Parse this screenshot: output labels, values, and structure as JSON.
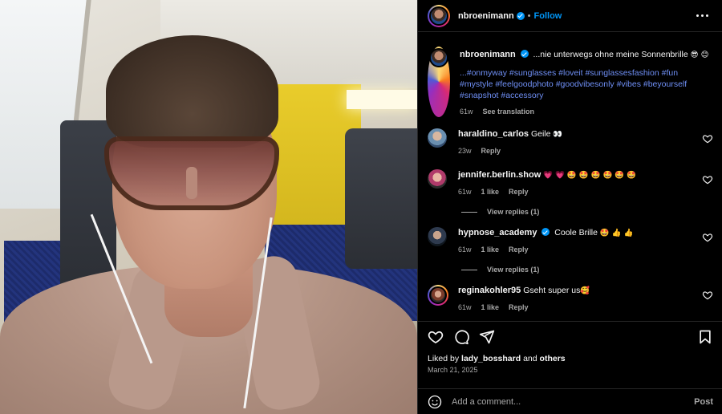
{
  "post": {
    "author": "nbroenimann",
    "follow_label": "Follow",
    "separator": "•",
    "caption_text": "...nie unterwegs ohne meine Sonnenbrille",
    "caption_emojis": "😎 😊",
    "hashtags": [
      "...#onmyway",
      "#sunglasses",
      "#loveit",
      "#sunglassesfashion",
      "#fun",
      "#mystyle",
      "#feelgoodphoto",
      "#goodvibesonly",
      "#vibes",
      "#beyourself",
      "#snapshot",
      "#accessory"
    ],
    "caption_time": "61w",
    "see_translation": "See translation",
    "photo_alt": "Selfie with oversized sunglasses on a train"
  },
  "comments": [
    {
      "username": "haraldino_carlos",
      "verified": false,
      "text": "Geile",
      "emoji": "👀",
      "time": "23w",
      "likes": "",
      "reply": "Reply",
      "view_replies": ""
    },
    {
      "username": "jennifer.berlin.show",
      "verified": false,
      "text": "",
      "emoji": "💗 💗 🤩 🤩 🤩 🤩 🤩 🤩",
      "time": "61w",
      "likes": "1 like",
      "reply": "Reply",
      "view_replies": "View replies (1)"
    },
    {
      "username": "hypnose_academy",
      "verified": true,
      "text": "Coole Brille",
      "emoji": "🤩 👍 👍",
      "time": "61w",
      "likes": "1 like",
      "reply": "Reply",
      "view_replies": "View replies (1)"
    },
    {
      "username": "reginakohler95",
      "verified": false,
      "text": "Gseht super us",
      "emoji": "🥰",
      "time": "61w",
      "likes": "1 like",
      "reply": "Reply",
      "view_replies": ""
    }
  ],
  "likes": {
    "prefix": "Liked by",
    "user": "lady_bosshard",
    "and": "and",
    "others": "others"
  },
  "date": "March 21, 2025",
  "add_comment": {
    "placeholder": "Add a comment...",
    "post_label": "Post"
  },
  "icons": [
    "heart-icon",
    "comment-icon",
    "share-icon",
    "bookmark-icon",
    "emoji-icon",
    "more-options-icon"
  ]
}
